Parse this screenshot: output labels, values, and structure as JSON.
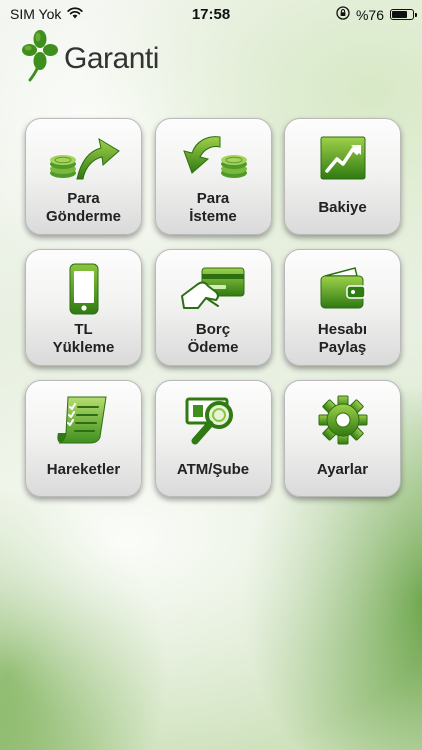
{
  "status_bar": {
    "carrier": "SIM Yok",
    "time": "17:58",
    "battery_text": "%76",
    "battery_level": 0.76,
    "wifi_icon": "wifi-icon",
    "lock_icon": "rotation-lock-icon"
  },
  "header": {
    "brand": "Garanti",
    "logo_icon": "clover-logo-icon"
  },
  "colors": {
    "brand_green": "#3f8f1f",
    "icon_green_light": "#8cc63f",
    "icon_green_dark": "#2f7a12"
  },
  "menu": {
    "para_gonderme": {
      "line1": "Para",
      "line2": "Gönderme",
      "icon": "coins-arrow-up-icon"
    },
    "para_isteme": {
      "line1": "Para",
      "line2": "İsteme",
      "icon": "coins-arrow-down-icon"
    },
    "bakiye": {
      "line1": "Bakiye",
      "icon": "rising-chart-icon"
    },
    "tl_yukleme": {
      "line1": "TL",
      "line2": "Yükleme",
      "icon": "mobile-phone-icon"
    },
    "borc_odeme": {
      "line1": "Borç",
      "line2": "Ödeme",
      "icon": "card-payment-icon"
    },
    "hesabi_paylas": {
      "line1": "Hesabı",
      "line2": "Paylaş",
      "icon": "wallet-icon"
    },
    "hareketler": {
      "line1": "Hareketler",
      "icon": "document-list-icon"
    },
    "atm_sube": {
      "line1": "ATM/Şube",
      "icon": "atm-search-icon"
    },
    "ayarlar": {
      "line1": "Ayarlar",
      "icon": "gear-icon"
    }
  }
}
